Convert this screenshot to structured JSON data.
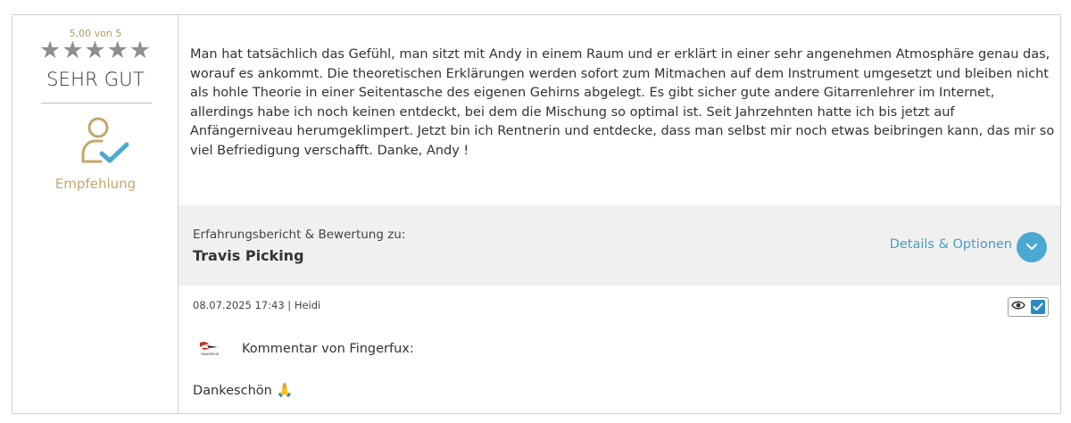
{
  "rating": {
    "score_text": "5,00 von 5",
    "stars": "★★★★★",
    "label": "SEHR GUT"
  },
  "recommendation": {
    "icon": "user-check-icon",
    "label": "Empfehlung"
  },
  "review": {
    "text": "Man hat tatsächlich das Gefühl, man sitzt mit Andy in einem Raum und er erklärt in einer sehr angenehmen Atmosphäre genau das, worauf es ankommt. Die theoretischen Erklärungen werden sofort zum Mitmachen auf dem Instrument umgesetzt und bleiben nicht als hohle Theorie in einer Seitentasche des eigenen Gehirns abgelegt. Es gibt sicher gute andere Gitarrenlehrer im Internet, allerdings habe ich noch keinen entdeckt, bei dem die Mischung so optimal ist. Seit Jahrzehnten hatte ich bis jetzt auf Anfängerniveau herumgeklimpert. Jetzt bin ich Rentnerin und entdecke, dass man selbst mir noch etwas beibringen kann, das mir so viel Befriedigung verschafft. Danke, Andy !"
  },
  "course_bar": {
    "label": "Erfahrungsbericht & Bewertung zu:",
    "course": "Travis Picking",
    "details_link": "Details & Optionen",
    "details_icon": "chevron-down-icon"
  },
  "meta": {
    "date_author": "08.07.2025 17:43 | Heidi",
    "visibility_icons": [
      "eye-icon",
      "checkbox-checked-icon"
    ]
  },
  "comment": {
    "logo_text": "FINGERFUX",
    "heading": "Kommentar von Fingerfux:",
    "text": "Dankeschön",
    "emoji": "🙏"
  },
  "colors": {
    "gold": "#c3a86d",
    "accent_blue": "#4ba9d1",
    "gray_bar": "#f0f0f0",
    "star_gray": "#8e8e8e"
  }
}
